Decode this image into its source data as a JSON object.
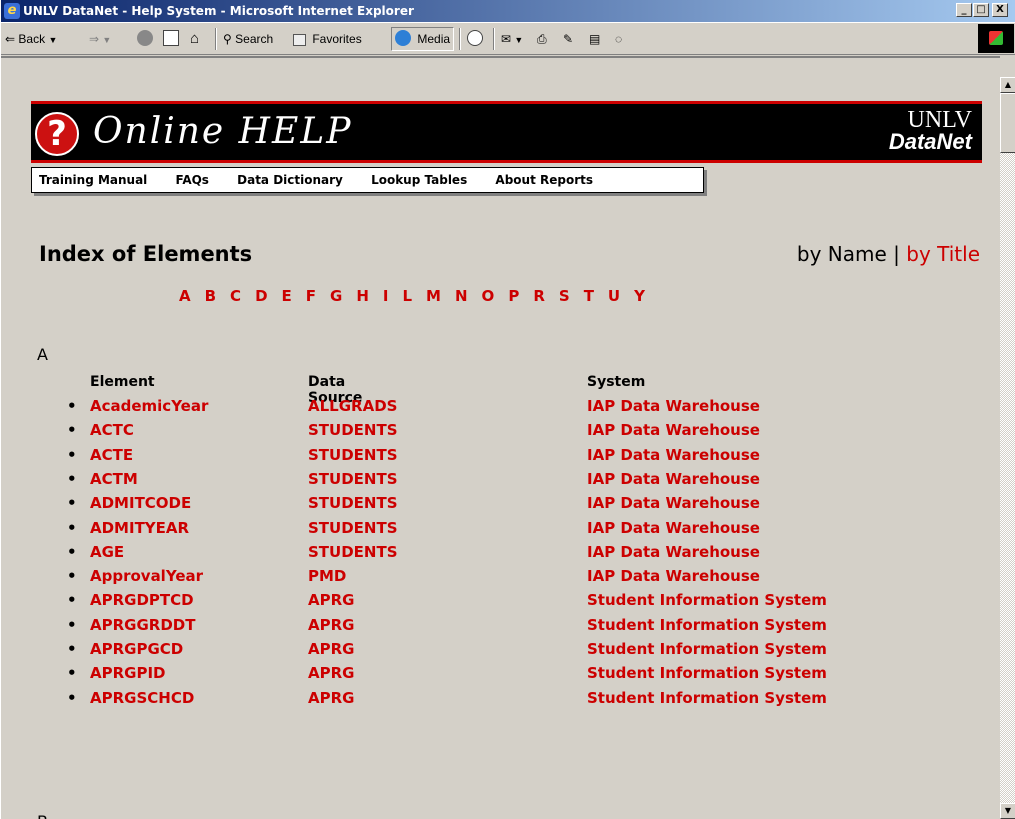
{
  "window": {
    "title": "UNLV DataNet - Help System - Microsoft Internet Explorer",
    "min": "_",
    "max": "□",
    "close": "X"
  },
  "toolbar": {
    "back": "Back",
    "search": "Search",
    "favorites": "Favorites",
    "media": "Media"
  },
  "banner": {
    "title": "Online HELP",
    "logo_line1": "UNLV",
    "logo_line2": "DataNet"
  },
  "nav": [
    "Training Manual",
    "FAQs",
    "Data Dictionary",
    "Lookup Tables",
    "About Reports"
  ],
  "index": {
    "title": "Index of Elements",
    "by_name": "by Name",
    "separator": " | ",
    "by_title": "by Title",
    "letters": [
      "A",
      "B",
      "C",
      "D",
      "E",
      "F",
      "G",
      "H",
      "I",
      "L",
      "M",
      "N",
      "O",
      "P",
      "R",
      "S",
      "T",
      "U",
      "Y"
    ]
  },
  "section_a": {
    "letter": "A",
    "columns": [
      "Element",
      "Data Source",
      "System"
    ],
    "rows": [
      [
        "AcademicYear",
        "ALLGRADS",
        "IAP Data Warehouse"
      ],
      [
        "ACTC",
        "STUDENTS",
        "IAP Data Warehouse"
      ],
      [
        "ACTE",
        "STUDENTS",
        "IAP Data Warehouse"
      ],
      [
        "ACTM",
        "STUDENTS",
        "IAP Data Warehouse"
      ],
      [
        "ADMITCODE",
        "STUDENTS",
        "IAP Data Warehouse"
      ],
      [
        "ADMITYEAR",
        "STUDENTS",
        "IAP Data Warehouse"
      ],
      [
        "AGE",
        "STUDENTS",
        "IAP Data Warehouse"
      ],
      [
        "ApprovalYear",
        "PMD",
        "IAP Data Warehouse"
      ],
      [
        "APRGDPTCD",
        "APRG",
        "Student Information System"
      ],
      [
        "APRGGRDDT",
        "APRG",
        "Student Information System"
      ],
      [
        "APRGPGCD",
        "APRG",
        "Student Information System"
      ],
      [
        "APRGPID",
        "APRG",
        "Student Information System"
      ],
      [
        "APRGSCHCD",
        "APRG",
        "Student Information System"
      ]
    ]
  },
  "section_b": {
    "letter": "B"
  },
  "colors": {
    "accent": "#cc0000",
    "banner_bg": "#000000",
    "page_bg": "#d4d0c8"
  }
}
